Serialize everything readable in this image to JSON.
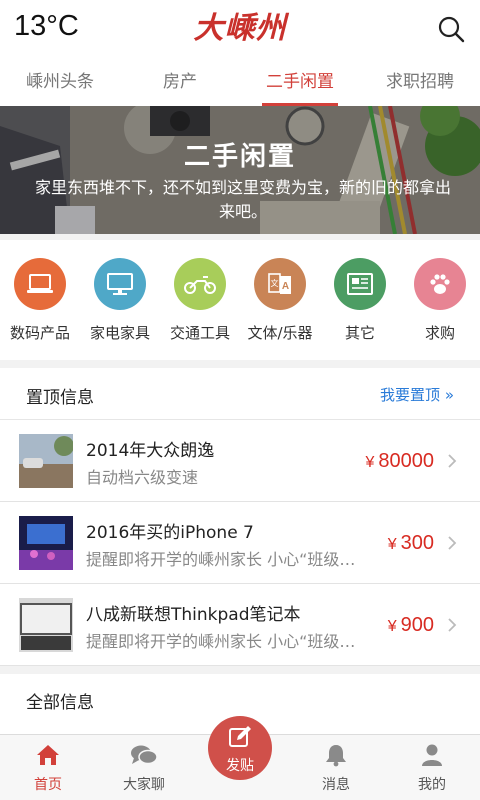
{
  "header": {
    "temperature": "13°C",
    "logo_text": "大嵊州"
  },
  "tabs": [
    {
      "label": "嵊州头条",
      "active": false
    },
    {
      "label": "房产",
      "active": false
    },
    {
      "label": "二手闲置",
      "active": true
    },
    {
      "label": "求职招聘",
      "active": false
    }
  ],
  "banner": {
    "title": "二手闲置",
    "description": "家里东西堆不下，还不如到这里变费为宝，新的旧的都拿出来吧。"
  },
  "categories": [
    {
      "label": "数码产品",
      "icon": "laptop-icon",
      "color": "#e66b3a"
    },
    {
      "label": "家电家具",
      "icon": "monitor-icon",
      "color": "#4fa8c8"
    },
    {
      "label": "交通工具",
      "icon": "motorcycle-icon",
      "color": "#a8cd5a"
    },
    {
      "label": "文体/乐器",
      "icon": "translate-book-icon",
      "color": "#c98456"
    },
    {
      "label": "其它",
      "icon": "newspaper-icon",
      "color": "#4c9d63"
    },
    {
      "label": "求购",
      "icon": "paw-icon",
      "color": "#e78493"
    }
  ],
  "pinned": {
    "title": "置顶信息",
    "link": "我要置顶 »",
    "items": [
      {
        "title": "2014年大众朗逸",
        "subtitle": "自动档六级变速",
        "currency": "¥",
        "price": "80000"
      },
      {
        "title": "2016年买的iPhone 7",
        "subtitle": "提醒即将开学的嵊州家长 小心“班级群”诈骗",
        "currency": "¥",
        "price": "300"
      },
      {
        "title": "八成新联想Thinkpad笔记本",
        "subtitle": "提醒即将开学的嵊州家长 小心“班级群”诈骗",
        "currency": "¥",
        "price": "900"
      }
    ]
  },
  "all_info": {
    "title": "全部信息"
  },
  "bottom_nav": {
    "home": "首页",
    "chat": "大家聊",
    "post": "发贴",
    "messages": "消息",
    "me": "我的"
  },
  "colors": {
    "accent": "#d2403a",
    "price": "#d82b22",
    "link": "#2a7bd8"
  }
}
